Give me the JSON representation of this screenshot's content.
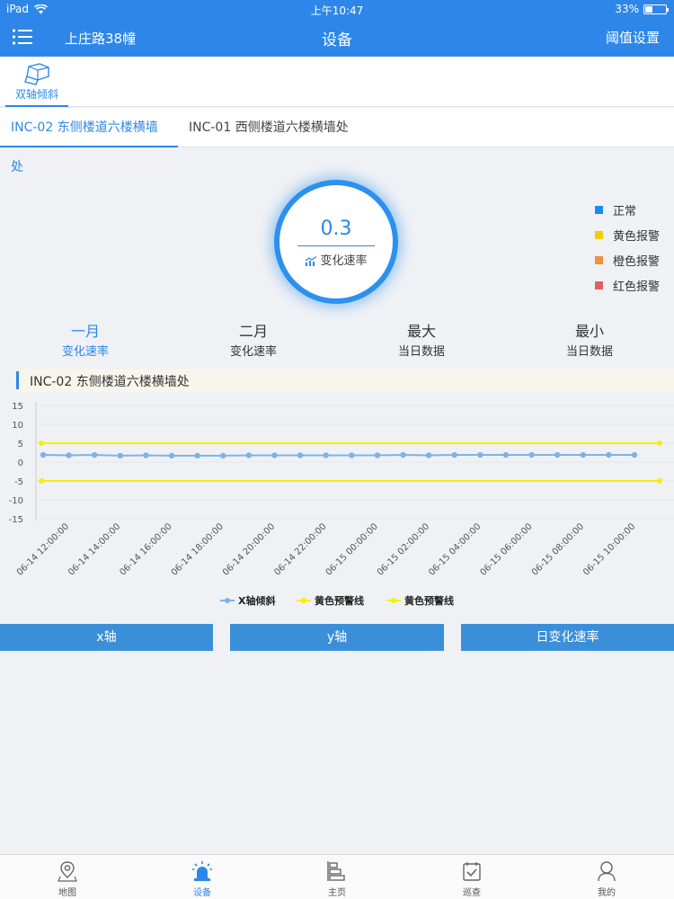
{
  "status_bar": {
    "device": "iPad",
    "time": "上午10:47",
    "battery": "33%"
  },
  "nav": {
    "location": "上庄路38幢",
    "title": "设备",
    "right_action": "阈值设置"
  },
  "device_types": [
    {
      "label": "双轴倾斜",
      "icon": "tilt-sensor-icon"
    }
  ],
  "sensor_tabs": [
    {
      "label": "INC-02 东侧楼道六楼横墙处",
      "active": true
    },
    {
      "label": "INC-01 西侧楼道六楼横墙处",
      "active": false
    }
  ],
  "gauge": {
    "value": "0.3",
    "label": "变化速率",
    "icon": "trend-chart-icon"
  },
  "status_legend": [
    {
      "label": "正常",
      "color": "#1a8cf0"
    },
    {
      "label": "黄色报警",
      "color": "#f0d000"
    },
    {
      "label": "橙色报警",
      "color": "#f09040"
    },
    {
      "label": "红色报警",
      "color": "#e06060"
    }
  ],
  "stats": [
    {
      "main": "一月",
      "sub": "变化速率",
      "active": true
    },
    {
      "main": "二月",
      "sub": "变化速率",
      "active": false
    },
    {
      "main": "最大",
      "sub": "当日数据",
      "active": false
    },
    {
      "main": "最小",
      "sub": "当日数据",
      "active": false
    }
  ],
  "chart_title": "INC-02 东侧楼道六楼横墙处",
  "chart_data": {
    "type": "line",
    "title": "INC-02 东侧楼道六楼横墙处",
    "y_ticks": [
      15,
      10,
      5,
      0,
      -5,
      -10,
      -15
    ],
    "ylim": [
      -15,
      15
    ],
    "x_labels": [
      "06-14 12:00:00",
      "06-14 14:00:00",
      "06-14 16:00:00",
      "06-14 18:00:00",
      "06-14 20:00:00",
      "06-14 22:00:00",
      "06-15 00:00:00",
      "06-15 02:00:00",
      "06-15 04:00:00",
      "06-15 06:00:00",
      "06-15 08:00:00",
      "06-15 10:00:00"
    ],
    "series": [
      {
        "name": "X轴倾斜",
        "color": "#7fb2e5",
        "values": [
          1.9,
          1.8,
          1.9,
          1.7,
          1.8,
          1.7,
          1.7,
          1.7,
          1.8,
          1.8,
          1.8,
          1.8,
          1.8,
          1.8,
          1.9,
          1.8,
          1.9,
          1.9,
          1.9,
          1.9,
          1.9,
          1.9,
          1.9,
          1.9
        ]
      },
      {
        "name": "黄色预警线",
        "color": "#f5f000",
        "values": [
          5,
          5
        ]
      },
      {
        "name": "黄色预警线",
        "color": "#f5f000",
        "values": [
          -5,
          -5
        ]
      }
    ],
    "legend_position": "bottom"
  },
  "axis_buttons": [
    "x轴",
    "y轴",
    "日变化速率"
  ],
  "tabbar": [
    {
      "label": "地图",
      "icon": "map-pin-icon",
      "active": false
    },
    {
      "label": "设备",
      "icon": "alarm-light-icon",
      "active": true
    },
    {
      "label": "主页",
      "icon": "home-chart-icon",
      "active": false
    },
    {
      "label": "巡查",
      "icon": "checklist-icon",
      "active": false
    },
    {
      "label": "我的",
      "icon": "user-icon",
      "active": false
    }
  ]
}
